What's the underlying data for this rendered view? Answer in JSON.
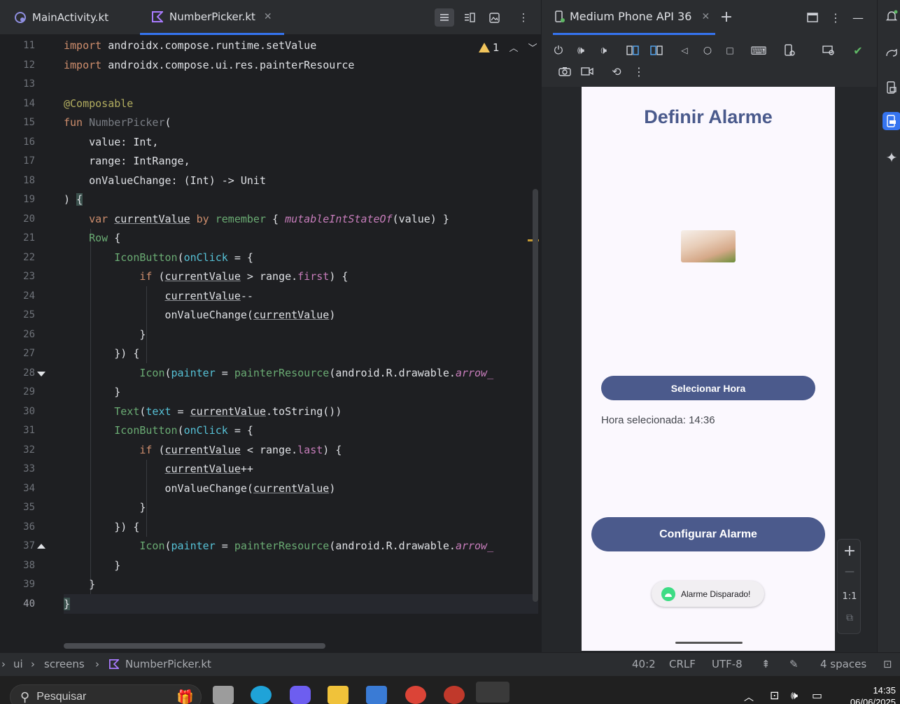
{
  "editor": {
    "tabs": [
      {
        "label": "MainActivity.kt",
        "active": false
      },
      {
        "label": "NumberPicker.kt",
        "active": true
      }
    ],
    "inspection": {
      "count": "1"
    },
    "line_numbers": [
      "11",
      "12",
      "13",
      "14",
      "15",
      "16",
      "17",
      "18",
      "19",
      "20",
      "21",
      "22",
      "23",
      "24",
      "25",
      "26",
      "27",
      "28",
      "29",
      "30",
      "31",
      "32",
      "33",
      "34",
      "35",
      "36",
      "37",
      "38",
      "39",
      "40"
    ]
  },
  "emulator": {
    "tab_title": "Medium Phone API 36",
    "app": {
      "title": "Definir Alarme",
      "select_button": "Selecionar Hora",
      "selected_time_text": "Hora selecionada: 14:36",
      "configure_button": "Configurar Alarme",
      "toast": "Alarme Disparado!"
    },
    "zoom": {
      "plus": "+",
      "minus": "—",
      "ratio": "1:1"
    }
  },
  "statusbar": {
    "breadcrumb": [
      "ui",
      "screens",
      "NumberPicker.kt"
    ],
    "position": "40:2",
    "line_ending": "CRLF",
    "encoding": "UTF-8",
    "indent": "4 spaces"
  },
  "taskbar": {
    "search_placeholder": "Pesquisar",
    "time": "14:35",
    "date": "06/06/2025"
  },
  "colors": {
    "accent": "#3574f0",
    "app_primary": "#4b5a8c",
    "app_title": "#4a5a8c"
  }
}
